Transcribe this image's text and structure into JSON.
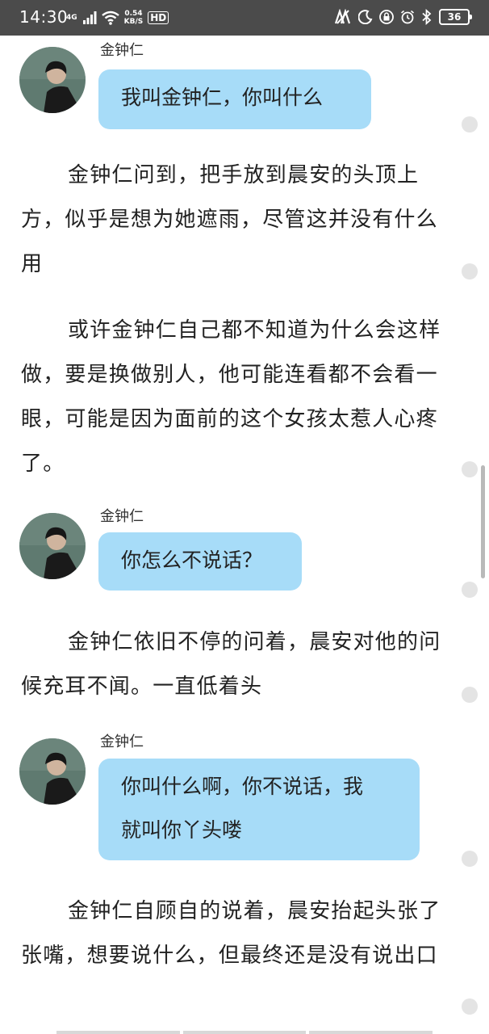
{
  "status_bar": {
    "time": "14:30",
    "network_tag": "4G",
    "speed_value": "0.54",
    "speed_unit": "KB/S",
    "hd": "HD",
    "battery": "36",
    "icons": [
      "signal-icon",
      "wifi-icon",
      "nfc-icon",
      "moon-icon",
      "lock-icon",
      "alarm-icon",
      "bluetooth-icon",
      "battery-icon"
    ]
  },
  "story": {
    "chats": [
      {
        "speaker": "金钟仁",
        "message_lines": [
          "我叫金钟仁，你叫什么"
        ]
      },
      {
        "speaker": "金钟仁",
        "message_lines": [
          "你怎么不说话？"
        ]
      },
      {
        "speaker": "金钟仁",
        "message_lines": [
          "你叫什么啊，你不说话，我",
          "就叫你丫头喽"
        ]
      }
    ],
    "paragraphs": [
      "金钟仁问到，把手放到晨安的头顶上方，似乎是想为她遮雨，尽管这并没有什么用",
      "或许金钟仁自己都不知道为什么会这样做，要是换做别人，他可能连看都不会看一眼，可能是因为面前的这个女孩太惹人心疼了。",
      "金钟仁依旧不停的问着，晨安对他的问候充耳不闻。一直低着头",
      "金钟仁自顾自的说着，晨安抬起头张了张嘴，想要说什么，但最终还是没有说出口"
    ]
  },
  "colors": {
    "status_bar": "#4b4b4b",
    "bubble": "#a7dcf8",
    "text": "#222222",
    "dot": "#e4e4e4",
    "scrollbar": "#b9b9b9"
  }
}
